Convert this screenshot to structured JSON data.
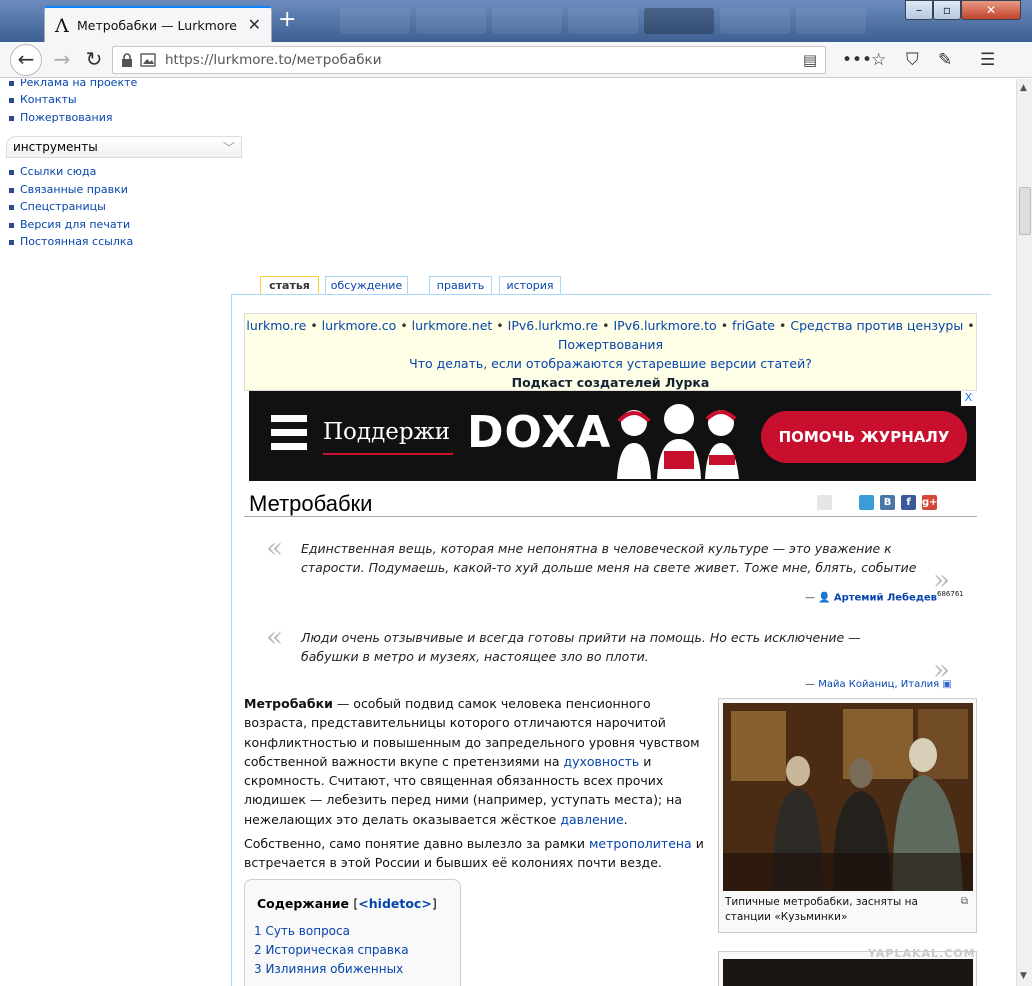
{
  "browser": {
    "tab_title": "Метробабки — Lurkmore",
    "tab_logo": "Λ",
    "url_host": "https://lurkmore.to/",
    "url_path": "метробабки"
  },
  "sidebar": {
    "top_items": [
      "Реклама на проекте",
      "Контакты",
      "Пожертвования"
    ],
    "tools_heading": "инструменты",
    "tools_items": [
      "Ссылки сюда",
      "Связанные правки",
      "Спецстраницы",
      "Версия для печати",
      "Постоянная ссылка"
    ]
  },
  "page_tabs": [
    "статья",
    "обсуждение",
    "править",
    "история"
  ],
  "notice": {
    "mirrors": [
      "lurkmo.re",
      "lurkmore.co",
      "lurkmore.net",
      "IPv6.lurkmo.re",
      "IPv6.lurkmore.to",
      "friGate",
      "Средства против цензуры"
    ],
    "separator": "•",
    "donations": "Пожертвования",
    "outdated": "Что делать, если отображаются устаревшие версии статей?",
    "podcast": "Подкаст создателей Лурка"
  },
  "banner": {
    "support": "Поддержи",
    "brand": "DOXA",
    "cta": "ПОМОЧЬ ЖУРНАЛУ",
    "close": "X"
  },
  "article": {
    "title": "Метробабки",
    "share_icons": [
      "mail-icon",
      "pen-icon",
      "twitter-icon",
      "vk-icon",
      "facebook-icon",
      "google-plus-icon"
    ],
    "share_labels": [
      "",
      "",
      "",
      "B",
      "f",
      "g+"
    ],
    "quotes": [
      {
        "text": "Единственная вещь, которая мне непонятна в человеческой культуре — это уважение к старости. Подумаешь, какой-то хуй дольше меня на свете живет. Тоже мне, блять, событие",
        "dash": "—",
        "author": "Артемий Лебедев",
        "author_sup": "686761"
      },
      {
        "text": "Люди очень отзывчивые и всегда готовы прийти на помощь. Но есть исключение — бабушки в метро и музеях, настоящее зло во плоти.",
        "dash": "—",
        "author": "Майа Койаниц, Италия"
      }
    ],
    "intro_bold": "Метробабки",
    "intro_p1": " — особый подвид самок человека пенсионного возраста, представительницы которого отличаются нарочитой конфликтностью и повышенным до запредельного уровня чувством собственной важности вкупе с претензиями на ",
    "link_spirit": "духовность",
    "intro_p1b": " и скромность. Считают, что священная обязанность всех прочих людишек — лебезить перед ними (например, уступать места); на нежелающих это делать оказывается жёсткое ",
    "link_pressure": "давление",
    "intro_p1c": ".",
    "p2a": "Собственно, само понятие давно вылезло за рамки ",
    "link_metro": "метрополитена",
    "p2b": " и встречается в этой России и бывших её колониях почти везде.",
    "thumb_caption": "Типичные метробабки, засняты на станции «Кузьминки»",
    "toc": {
      "title": "Содержание",
      "toggle_open": "[",
      "toggle": "<hidetoc>",
      "toggle_close": "]",
      "items": [
        "1 Суть вопроса",
        "2 Историческая справка",
        "3 Излияния обиженных"
      ]
    }
  },
  "watermark": "YAPLAKAL.COM"
}
